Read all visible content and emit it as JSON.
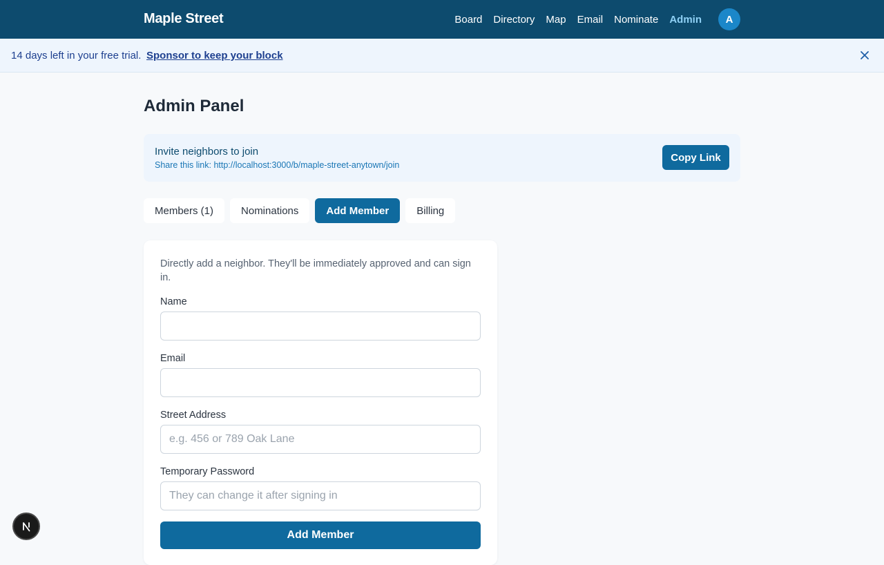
{
  "app": {
    "brand": "Maple Street",
    "nav": [
      {
        "label": "Board"
      },
      {
        "label": "Directory"
      },
      {
        "label": "Map"
      },
      {
        "label": "Email"
      },
      {
        "label": "Nominate"
      },
      {
        "label": "Admin",
        "active": true
      }
    ],
    "avatar_initial": "A"
  },
  "trial_banner": {
    "text": "14 days left in your free trial.",
    "link": "Sponsor to keep your block",
    "close_icon": "close-icon"
  },
  "page": {
    "title": "Admin Panel"
  },
  "invite": {
    "title": "Invite neighbors to join",
    "link_text": "Share this link: http://localhost:3000/b/maple-street-anytown/join",
    "copy_button": "Copy Link"
  },
  "tabs": [
    {
      "label": "Members (1)"
    },
    {
      "label": "Nominations"
    },
    {
      "label": "Add Member",
      "active": true
    },
    {
      "label": "Billing"
    }
  ],
  "form": {
    "description": "Directly add a neighbor. They'll be immediately approved and can sign in.",
    "fields": [
      {
        "label": "Name",
        "value": "",
        "placeholder": ""
      },
      {
        "label": "Email",
        "value": "",
        "placeholder": ""
      },
      {
        "label": "Street Address",
        "value": "",
        "placeholder": "e.g. 456 or 789 Oak Lane"
      },
      {
        "label": "Temporary Password",
        "value": "",
        "placeholder": "They can change it after signing in"
      }
    ],
    "submit": "Add Member"
  },
  "colors": {
    "nav_bg": "#0d4b6e",
    "accent": "#0f6a9e",
    "active_nav": "#8fd0f5",
    "banner_bg": "#eef5fd",
    "avatar_bg": "#1b87c9"
  },
  "dev_badge": {
    "icon": "nextjs-logo-icon"
  }
}
